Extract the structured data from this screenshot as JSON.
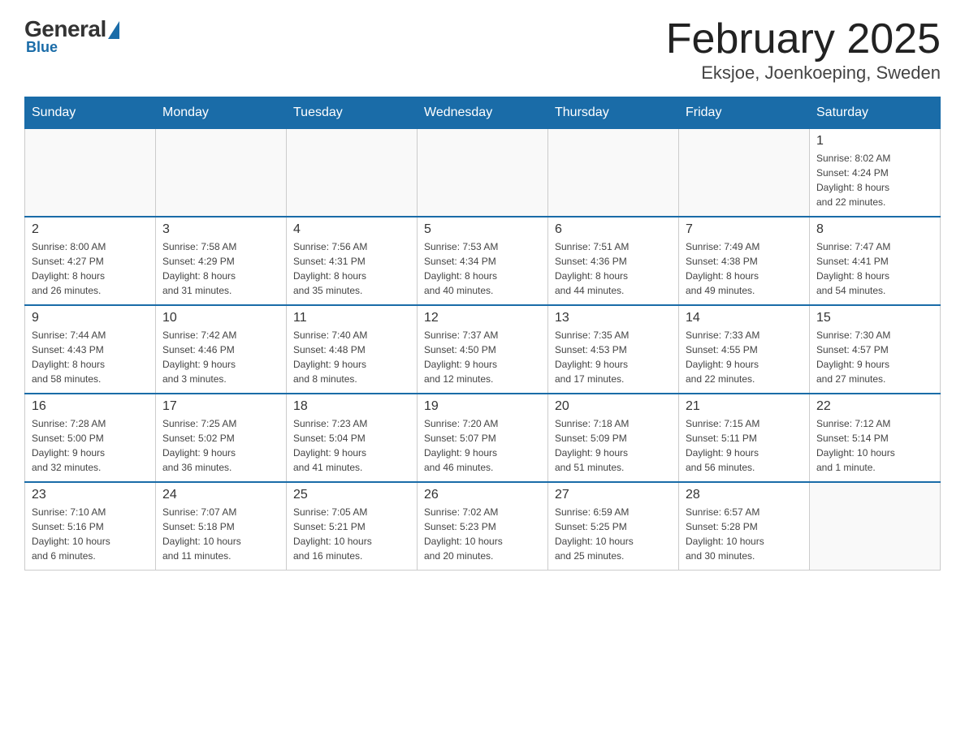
{
  "logo": {
    "general": "General",
    "blue": "Blue",
    "sub": "Blue"
  },
  "header": {
    "month_year": "February 2025",
    "location": "Eksjoe, Joenkoeping, Sweden"
  },
  "days_of_week": [
    "Sunday",
    "Monday",
    "Tuesday",
    "Wednesday",
    "Thursday",
    "Friday",
    "Saturday"
  ],
  "weeks": [
    [
      {
        "day": "",
        "info": ""
      },
      {
        "day": "",
        "info": ""
      },
      {
        "day": "",
        "info": ""
      },
      {
        "day": "",
        "info": ""
      },
      {
        "day": "",
        "info": ""
      },
      {
        "day": "",
        "info": ""
      },
      {
        "day": "1",
        "info": "Sunrise: 8:02 AM\nSunset: 4:24 PM\nDaylight: 8 hours\nand 22 minutes."
      }
    ],
    [
      {
        "day": "2",
        "info": "Sunrise: 8:00 AM\nSunset: 4:27 PM\nDaylight: 8 hours\nand 26 minutes."
      },
      {
        "day": "3",
        "info": "Sunrise: 7:58 AM\nSunset: 4:29 PM\nDaylight: 8 hours\nand 31 minutes."
      },
      {
        "day": "4",
        "info": "Sunrise: 7:56 AM\nSunset: 4:31 PM\nDaylight: 8 hours\nand 35 minutes."
      },
      {
        "day": "5",
        "info": "Sunrise: 7:53 AM\nSunset: 4:34 PM\nDaylight: 8 hours\nand 40 minutes."
      },
      {
        "day": "6",
        "info": "Sunrise: 7:51 AM\nSunset: 4:36 PM\nDaylight: 8 hours\nand 44 minutes."
      },
      {
        "day": "7",
        "info": "Sunrise: 7:49 AM\nSunset: 4:38 PM\nDaylight: 8 hours\nand 49 minutes."
      },
      {
        "day": "8",
        "info": "Sunrise: 7:47 AM\nSunset: 4:41 PM\nDaylight: 8 hours\nand 54 minutes."
      }
    ],
    [
      {
        "day": "9",
        "info": "Sunrise: 7:44 AM\nSunset: 4:43 PM\nDaylight: 8 hours\nand 58 minutes."
      },
      {
        "day": "10",
        "info": "Sunrise: 7:42 AM\nSunset: 4:46 PM\nDaylight: 9 hours\nand 3 minutes."
      },
      {
        "day": "11",
        "info": "Sunrise: 7:40 AM\nSunset: 4:48 PM\nDaylight: 9 hours\nand 8 minutes."
      },
      {
        "day": "12",
        "info": "Sunrise: 7:37 AM\nSunset: 4:50 PM\nDaylight: 9 hours\nand 12 minutes."
      },
      {
        "day": "13",
        "info": "Sunrise: 7:35 AM\nSunset: 4:53 PM\nDaylight: 9 hours\nand 17 minutes."
      },
      {
        "day": "14",
        "info": "Sunrise: 7:33 AM\nSunset: 4:55 PM\nDaylight: 9 hours\nand 22 minutes."
      },
      {
        "day": "15",
        "info": "Sunrise: 7:30 AM\nSunset: 4:57 PM\nDaylight: 9 hours\nand 27 minutes."
      }
    ],
    [
      {
        "day": "16",
        "info": "Sunrise: 7:28 AM\nSunset: 5:00 PM\nDaylight: 9 hours\nand 32 minutes."
      },
      {
        "day": "17",
        "info": "Sunrise: 7:25 AM\nSunset: 5:02 PM\nDaylight: 9 hours\nand 36 minutes."
      },
      {
        "day": "18",
        "info": "Sunrise: 7:23 AM\nSunset: 5:04 PM\nDaylight: 9 hours\nand 41 minutes."
      },
      {
        "day": "19",
        "info": "Sunrise: 7:20 AM\nSunset: 5:07 PM\nDaylight: 9 hours\nand 46 minutes."
      },
      {
        "day": "20",
        "info": "Sunrise: 7:18 AM\nSunset: 5:09 PM\nDaylight: 9 hours\nand 51 minutes."
      },
      {
        "day": "21",
        "info": "Sunrise: 7:15 AM\nSunset: 5:11 PM\nDaylight: 9 hours\nand 56 minutes."
      },
      {
        "day": "22",
        "info": "Sunrise: 7:12 AM\nSunset: 5:14 PM\nDaylight: 10 hours\nand 1 minute."
      }
    ],
    [
      {
        "day": "23",
        "info": "Sunrise: 7:10 AM\nSunset: 5:16 PM\nDaylight: 10 hours\nand 6 minutes."
      },
      {
        "day": "24",
        "info": "Sunrise: 7:07 AM\nSunset: 5:18 PM\nDaylight: 10 hours\nand 11 minutes."
      },
      {
        "day": "25",
        "info": "Sunrise: 7:05 AM\nSunset: 5:21 PM\nDaylight: 10 hours\nand 16 minutes."
      },
      {
        "day": "26",
        "info": "Sunrise: 7:02 AM\nSunset: 5:23 PM\nDaylight: 10 hours\nand 20 minutes."
      },
      {
        "day": "27",
        "info": "Sunrise: 6:59 AM\nSunset: 5:25 PM\nDaylight: 10 hours\nand 25 minutes."
      },
      {
        "day": "28",
        "info": "Sunrise: 6:57 AM\nSunset: 5:28 PM\nDaylight: 10 hours\nand 30 minutes."
      },
      {
        "day": "",
        "info": ""
      }
    ]
  ]
}
